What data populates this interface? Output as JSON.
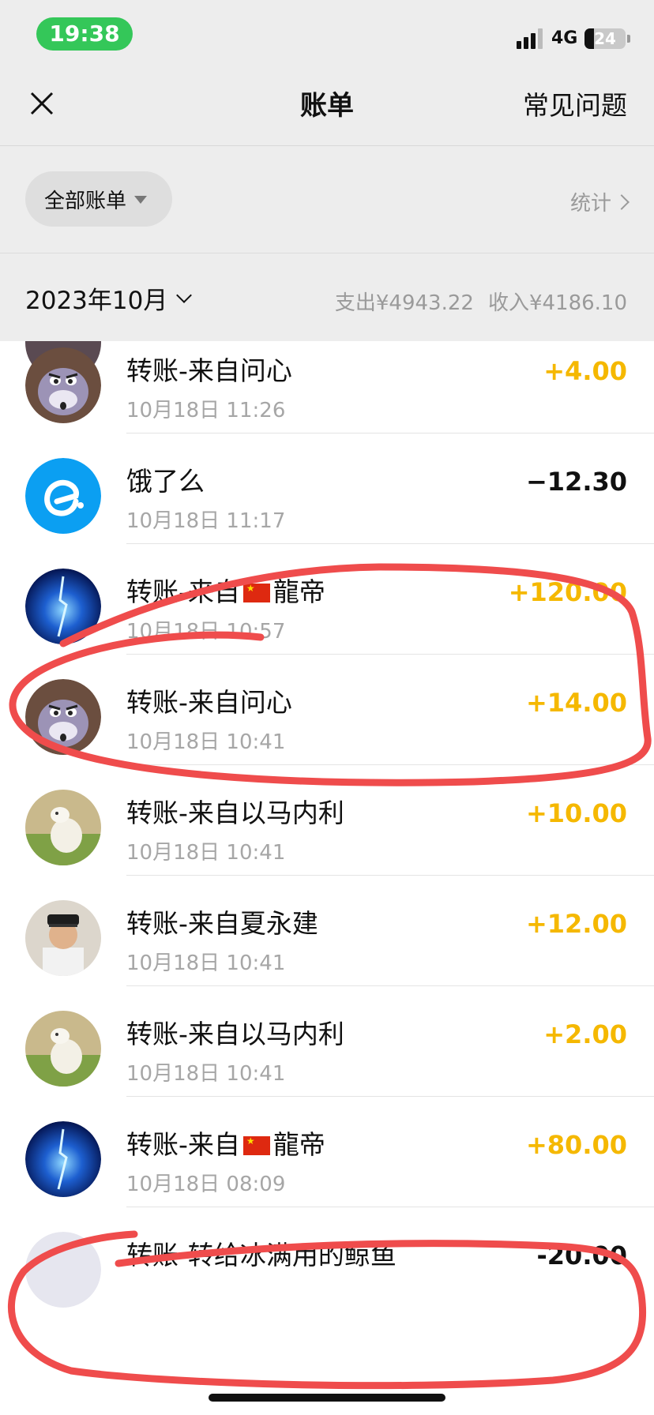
{
  "status_bar": {
    "time": "19:38",
    "network": "4G",
    "battery": "24",
    "battery_level_percent": 24
  },
  "nav": {
    "title": "账单",
    "faq": "常见问题",
    "close_icon": "close-icon"
  },
  "filter": {
    "label": "全部账单",
    "stats": "统计"
  },
  "month": {
    "label": "2023年10月",
    "expense": "支出¥4943.22",
    "income": "收入¥4186.10"
  },
  "colors": {
    "income": "#f5b800",
    "expense": "#111111",
    "annotation": "#ef4c4c",
    "status_pill": "#34c759"
  },
  "transactions": [
    {
      "title_prefix": "转账-来自问心",
      "title_suffix": "",
      "has_flag": false,
      "time": "10月18日 11:26",
      "amount": "+4.00",
      "type": "income",
      "avatar": "cartoon-face"
    },
    {
      "title_prefix": "饿了么",
      "title_suffix": "",
      "has_flag": false,
      "time": "10月18日 11:17",
      "amount": "−12.30",
      "type": "expense",
      "avatar": "eleme-logo"
    },
    {
      "title_prefix": "转账-来自",
      "title_suffix": "龍帝",
      "has_flag": true,
      "time": "10月18日 10:57",
      "amount": "+120.00",
      "type": "income",
      "avatar": "blue-light"
    },
    {
      "title_prefix": "转账-来自问心",
      "title_suffix": "",
      "has_flag": false,
      "time": "10月18日 10:41",
      "amount": "+14.00",
      "type": "income",
      "avatar": "cartoon-face"
    },
    {
      "title_prefix": "转账-来自以马内利",
      "title_suffix": "",
      "has_flag": false,
      "time": "10月18日 10:41",
      "amount": "+10.00",
      "type": "income",
      "avatar": "lamb-photo"
    },
    {
      "title_prefix": "转账-来自夏永建",
      "title_suffix": "",
      "has_flag": false,
      "time": "10月18日 10:41",
      "amount": "+12.00",
      "type": "income",
      "avatar": "officer-photo"
    },
    {
      "title_prefix": "转账-来自以马内利",
      "title_suffix": "",
      "has_flag": false,
      "time": "10月18日 10:41",
      "amount": "+2.00",
      "type": "income",
      "avatar": "lamb-photo"
    },
    {
      "title_prefix": "转账-来自",
      "title_suffix": "龍帝",
      "has_flag": true,
      "time": "10月18日 08:09",
      "amount": "+80.00",
      "type": "income",
      "avatar": "blue-light"
    },
    {
      "title_prefix": "转账-转给冰满用的鲸鱼",
      "title_suffix": "",
      "has_flag": false,
      "time": "",
      "amount": "-20.00",
      "type": "expense",
      "avatar": "partial"
    }
  ]
}
